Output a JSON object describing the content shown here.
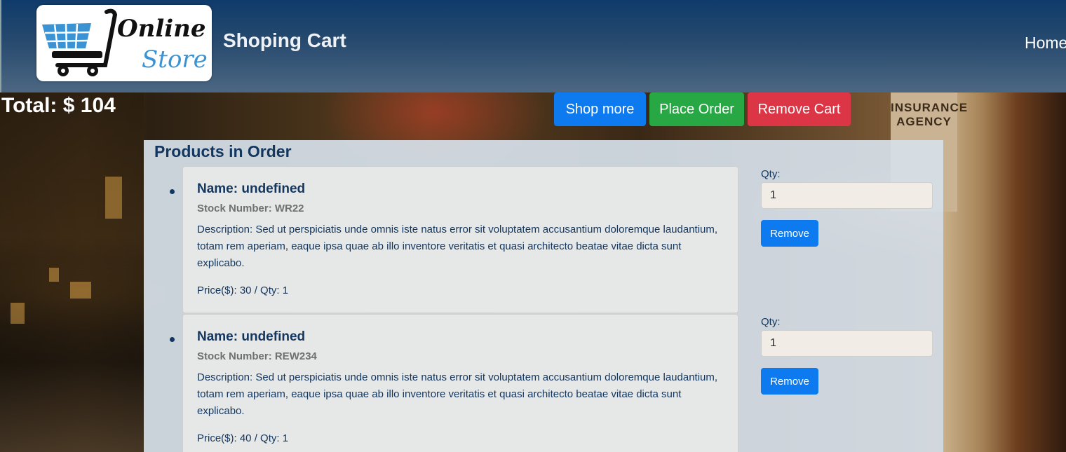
{
  "header": {
    "logo_word1": "Online",
    "logo_word2": "Store",
    "title": "Shoping Cart",
    "nav_home": "Home"
  },
  "total_label": "Total: $ 104",
  "actions": {
    "shop_more": "Shop more",
    "place_order": "Place Order",
    "remove_cart": "Remove Cart"
  },
  "products_title": "Products in Order",
  "products": [
    {
      "name": "Name: undefined",
      "stock": "Stock Number: WR22",
      "description": "Description: Sed ut perspiciatis unde omnis iste natus error sit voluptatem accusantium doloremque laudantium, totam rem aperiam, eaque ipsa quae ab illo inventore veritatis et quasi architecto beatae vitae dicta sunt explicabo.",
      "price": "Price($): 30 / Qty: 1",
      "qty_label": "Qty:",
      "qty_value": "1",
      "remove_label": "Remove"
    },
    {
      "name": "Name: undefined",
      "stock": "Stock Number: REW234",
      "description": "Description: Sed ut perspiciatis unde omnis iste natus error sit voluptatem accusantium doloremque laudantium, totam rem aperiam, eaque ipsa quae ab illo inventore veritatis et quasi architecto beatae vitae dicta sunt explicabo.",
      "price": "Price($): 40 / Qty: 1",
      "qty_label": "Qty:",
      "qty_value": "1",
      "remove_label": "Remove"
    }
  ],
  "background": {
    "sign_text": "INSURANCE AGENCY"
  },
  "colors": {
    "header_top": "#0f3b6b",
    "primary": "#0d7af0",
    "success": "#28a745",
    "danger": "#dc3545",
    "title_text": "#12365e"
  }
}
